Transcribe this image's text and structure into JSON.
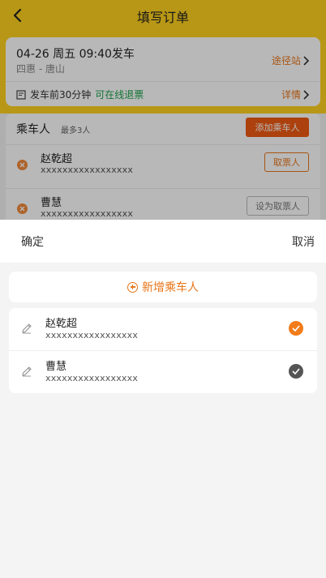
{
  "header": {
    "title": "填写订单"
  },
  "trip": {
    "datetime": "04-26 周五 09:40发车",
    "route": "四惠 - 唐山",
    "stations_link": "途径站",
    "refund_prefix": "发车前30分钟",
    "refund_highlight": "可在线退票",
    "details_link": "详情"
  },
  "passengers_section": {
    "title": "乘车人",
    "max_note": "最多3人",
    "add_button": "添加乘车人",
    "rows": [
      {
        "name": "赵乾超",
        "id": "xxxxxxxxxxxxxxxxx",
        "action": "取票人"
      },
      {
        "name": "曹慧",
        "id": "xxxxxxxxxxxxxxxxx",
        "action": "设为取票人"
      }
    ]
  },
  "sheet": {
    "confirm": "确定",
    "cancel": "取消",
    "add_new": "新增乘车人",
    "list": [
      {
        "name": "赵乾超",
        "id": "xxxxxxxxxxxxxxxxx",
        "selected": true
      },
      {
        "name": "曹慧",
        "id": "xxxxxxxxxxxxxxxxx",
        "selected": false
      }
    ]
  },
  "colors": {
    "brand_yellow": "#ffd21f",
    "accent_orange": "#e8761a",
    "add_button": "#ef5b12",
    "green": "#1aa34a"
  }
}
